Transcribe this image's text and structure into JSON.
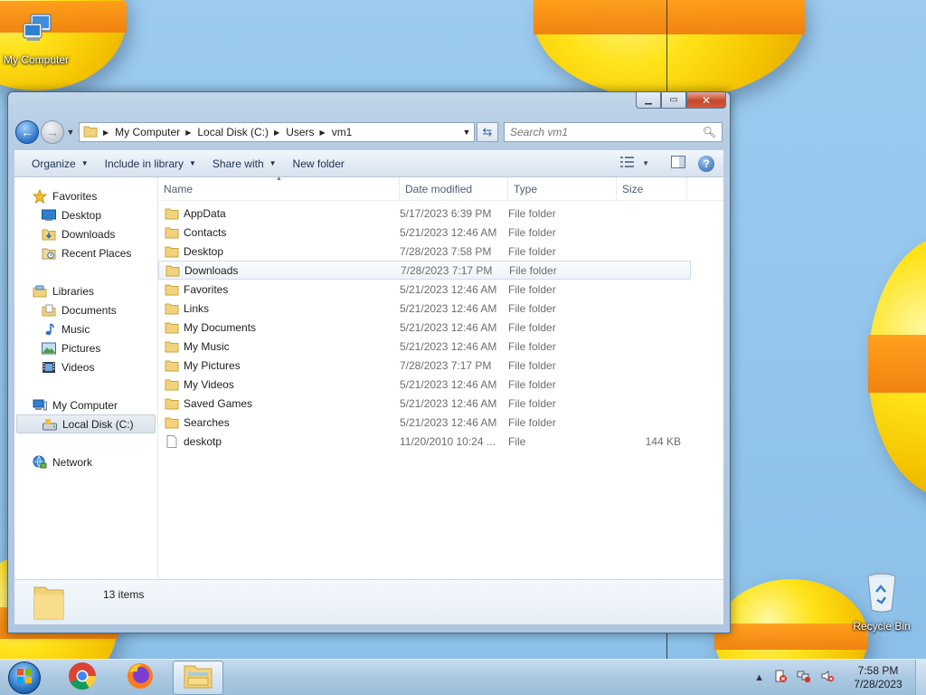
{
  "desktop": {
    "icons": [
      {
        "label": "My Computer"
      },
      {
        "label": "Recycle Bin"
      }
    ]
  },
  "window": {
    "address": {
      "crumbs": [
        "My Computer",
        "Local Disk (C:)",
        "Users",
        "vm1"
      ]
    },
    "search": {
      "placeholder": "Search vm1"
    },
    "toolbar": {
      "organize": "Organize",
      "include_in_library": "Include in library",
      "share_with": "Share with",
      "new_folder": "New folder"
    },
    "nav_pane": {
      "favorites": "Favorites",
      "favorites_items": [
        "Desktop",
        "Downloads",
        "Recent Places"
      ],
      "libraries": "Libraries",
      "libraries_items": [
        "Documents",
        "Music",
        "Pictures",
        "Videos"
      ],
      "my_computer": "My Computer",
      "computer_items": [
        "Local Disk (C:)"
      ],
      "network": "Network"
    },
    "columns": {
      "name": "Name",
      "date": "Date modified",
      "type": "Type",
      "size": "Size"
    },
    "files": [
      {
        "name": "AppData",
        "date": "5/17/2023 6:39 PM",
        "type": "File folder",
        "size": ""
      },
      {
        "name": "Contacts",
        "date": "5/21/2023 12:46 AM",
        "type": "File folder",
        "size": ""
      },
      {
        "name": "Desktop",
        "date": "7/28/2023 7:58 PM",
        "type": "File folder",
        "size": ""
      },
      {
        "name": "Downloads",
        "date": "7/28/2023 7:17 PM",
        "type": "File folder",
        "size": ""
      },
      {
        "name": "Favorites",
        "date": "5/21/2023 12:46 AM",
        "type": "File folder",
        "size": ""
      },
      {
        "name": "Links",
        "date": "5/21/2023 12:46 AM",
        "type": "File folder",
        "size": ""
      },
      {
        "name": "My Documents",
        "date": "5/21/2023 12:46 AM",
        "type": "File folder",
        "size": ""
      },
      {
        "name": "My Music",
        "date": "5/21/2023 12:46 AM",
        "type": "File folder",
        "size": ""
      },
      {
        "name": "My Pictures",
        "date": "7/28/2023 7:17 PM",
        "type": "File folder",
        "size": ""
      },
      {
        "name": "My Videos",
        "date": "5/21/2023 12:46 AM",
        "type": "File folder",
        "size": ""
      },
      {
        "name": "Saved Games",
        "date": "5/21/2023 12:46 AM",
        "type": "File folder",
        "size": ""
      },
      {
        "name": "Searches",
        "date": "5/21/2023 12:46 AM",
        "type": "File folder",
        "size": ""
      },
      {
        "name": "deskotp",
        "date": "11/20/2010 10:24 ...",
        "type": "File",
        "size": "144 KB"
      }
    ],
    "status": {
      "item_count": "13 items"
    }
  },
  "taskbar": {
    "clock_time": "7:58 PM",
    "clock_date": "7/28/2023"
  },
  "colors": {
    "accent": "#2a72c8",
    "wallpaper": "#8fc3ea"
  }
}
